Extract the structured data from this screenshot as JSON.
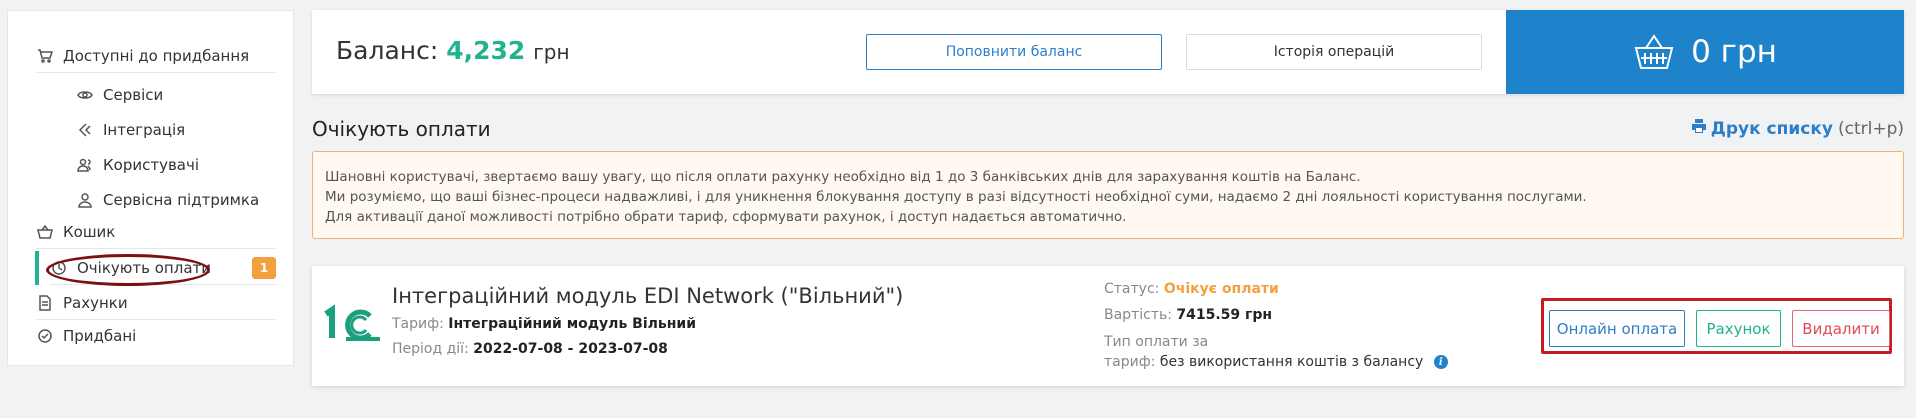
{
  "sidebar": {
    "items": [
      {
        "label": "Доступні до придбання",
        "icon": "cart-icon"
      },
      {
        "label": "Сервіси",
        "icon": "eye-icon"
      },
      {
        "label": "Інтеграція",
        "icon": "integration-icon"
      },
      {
        "label": "Користувачі",
        "icon": "users-icon"
      },
      {
        "label": "Сервісна підтримка",
        "icon": "support-icon"
      },
      {
        "label": "Кошик",
        "icon": "basket-icon"
      },
      {
        "label": "Очікують оплати",
        "icon": "clock-icon",
        "badge": "1",
        "active": true
      },
      {
        "label": "Рахунки",
        "icon": "document-icon"
      },
      {
        "label": "Придбані",
        "icon": "check-circle-icon"
      }
    ]
  },
  "balance": {
    "label": "Баланс:",
    "amount": "4,232",
    "currency": "грн",
    "topup_button": "Поповнити баланс",
    "history_button": "Історія операцій",
    "cart_total": "0 грн"
  },
  "section": {
    "title": "Очікують оплати",
    "print_label": "Друк списку",
    "print_hint": "(ctrl+p)"
  },
  "notice": {
    "lines": [
      "Шановні користувачі, звертаємо вашу увагу, що після оплати рахунку необхідно від 1 до 3 банківських днів для зарахування коштів на Баланс.",
      "Ми розуміємо, що ваші бізнес-процеси надважливі, і для уникнення блокування доступу в разі відсутності необхідної суми, надаємо 2 дні лояльності користування послугами.",
      "Для активації даної можливості потрібно обрати тариф, сформувати рахунок, і доступ надається автоматично."
    ]
  },
  "order": {
    "title": "Інтеграційний модуль EDI Network (\"Вільний\")",
    "tariff_label": "Тариф:",
    "tariff_value": "Інтеграційний модуль Вільний",
    "period_label": "Період дії:",
    "period_value": "2022-07-08 - 2023-07-08",
    "status_label": "Статус:",
    "status_value": "Очікує оплати",
    "cost_label": "Вартість:",
    "cost_value": "7415.59 грн",
    "payment_type_label_1": "Тип оплати за",
    "payment_type_label_2": "тариф:",
    "payment_type_value": "без використання коштів з балансу",
    "online_pay_button": "Онлайн оплата",
    "invoice_button": "Рахунок",
    "delete_button": "Видалити"
  },
  "colors": {
    "accent_green": "#1fb48e",
    "accent_blue": "#1f83cc",
    "status_orange": "#f5a03f",
    "highlight_red": "#c81a25"
  }
}
